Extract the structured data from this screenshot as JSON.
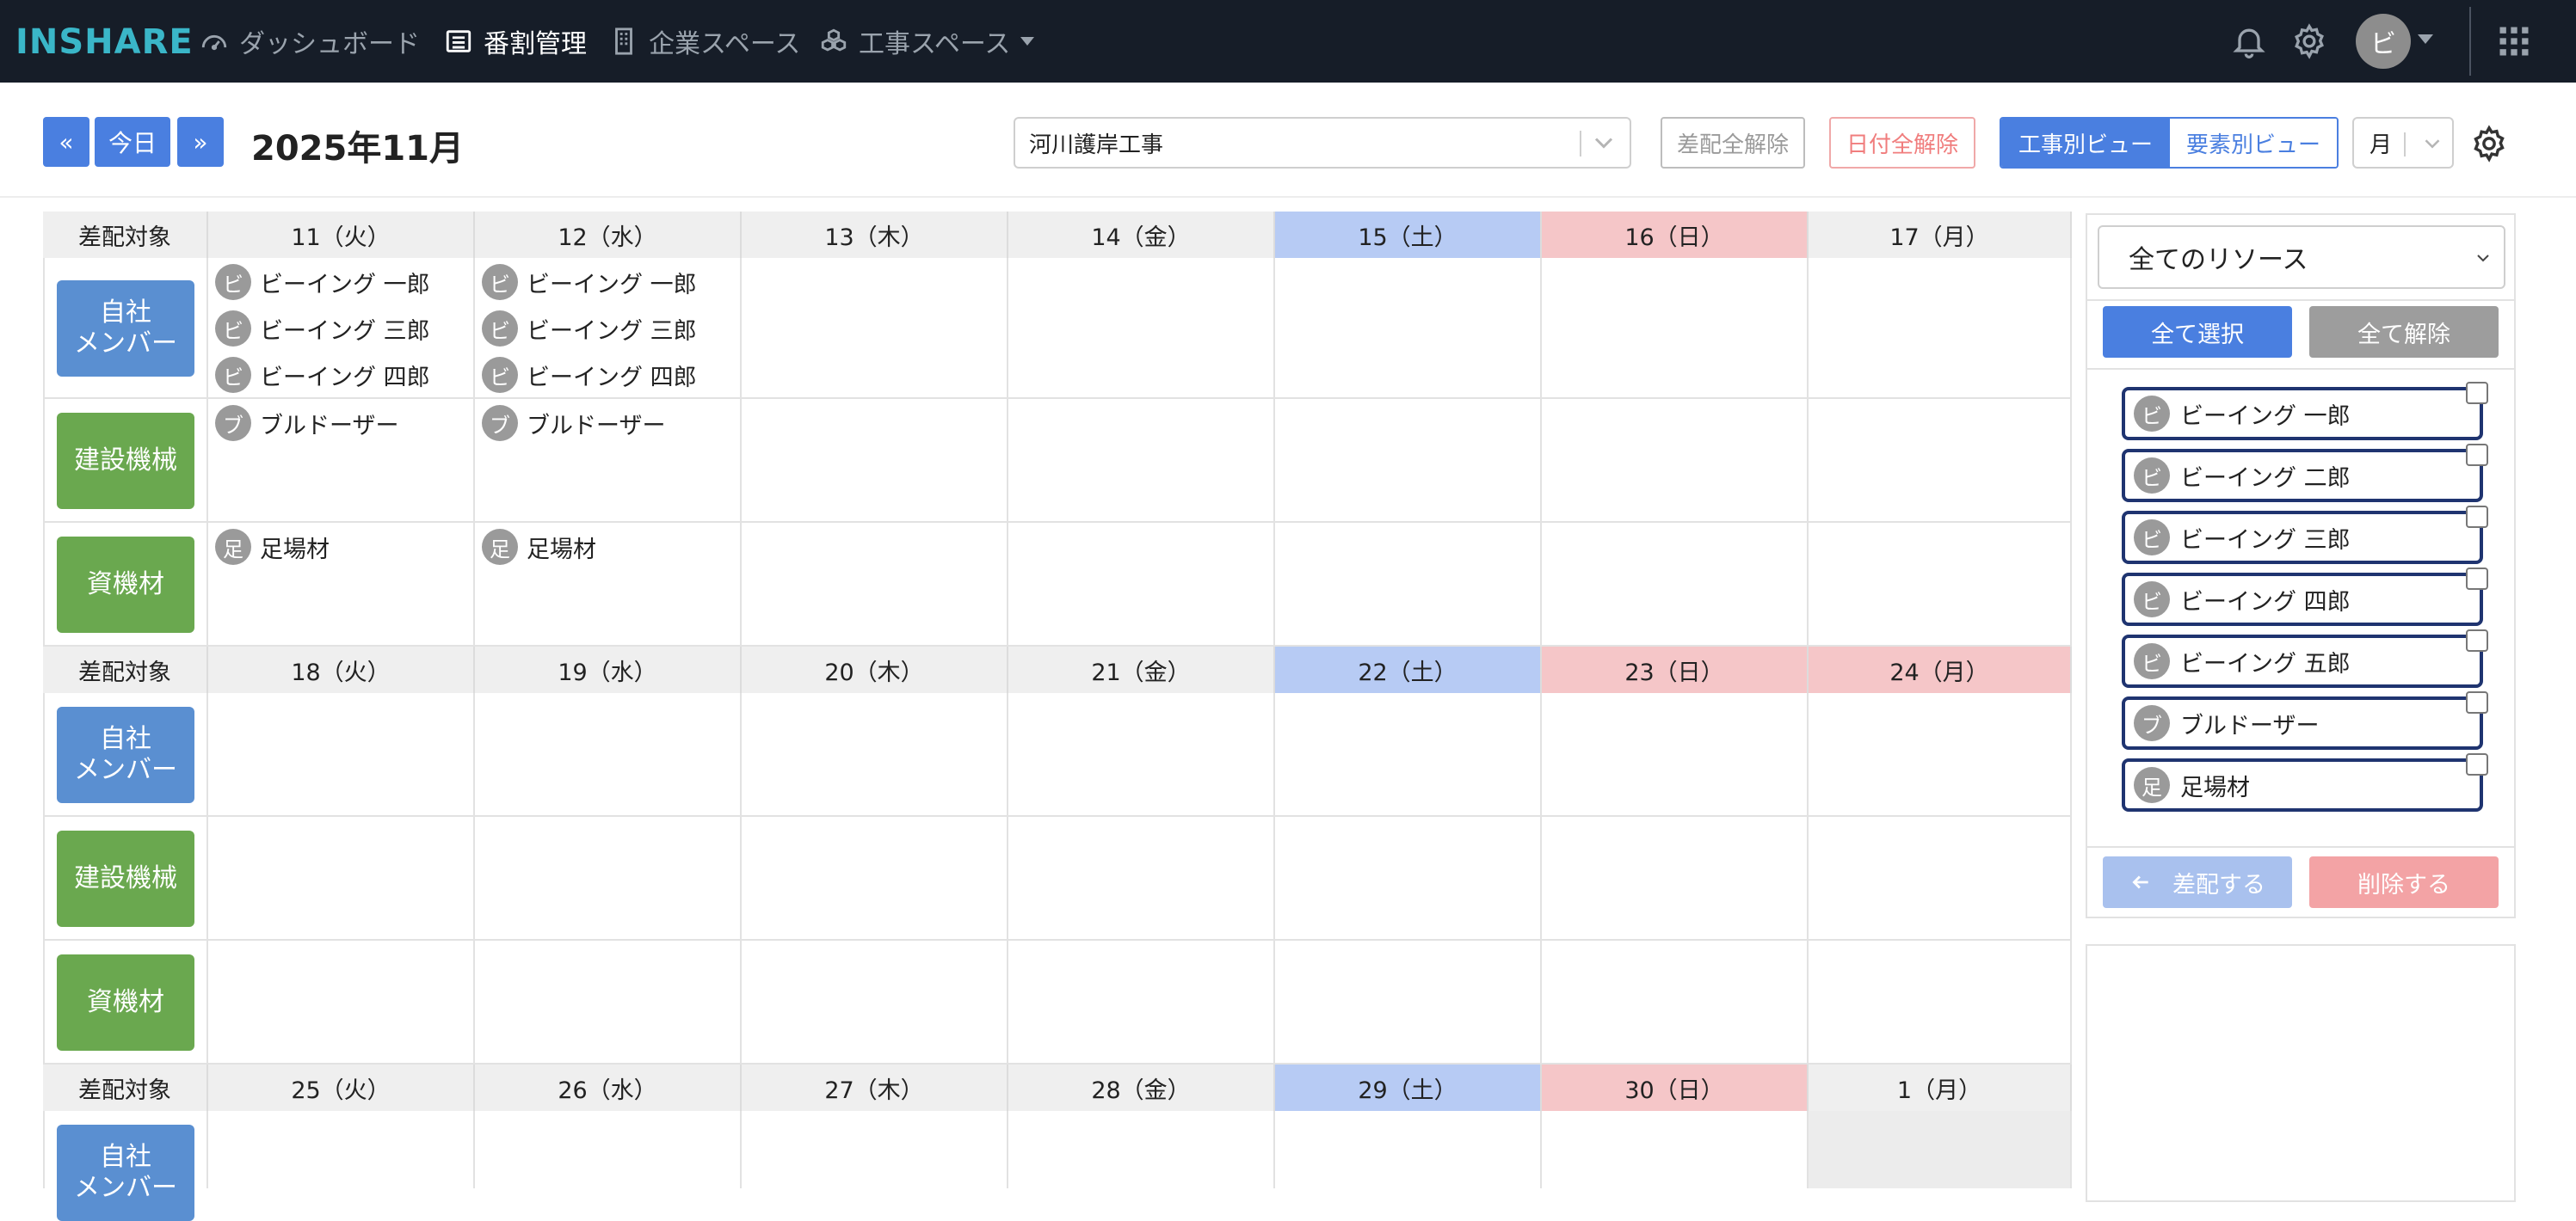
{
  "nav": {
    "logo": "INSHARE",
    "items": [
      {
        "label": "ダッシュボード",
        "icon": "dashboard-icon"
      },
      {
        "label": "番割管理",
        "icon": "list-icon"
      },
      {
        "label": "企業スペース",
        "icon": "building-icon"
      },
      {
        "label": "工事スペース",
        "icon": "cubes-icon"
      }
    ],
    "avatar": "ビ"
  },
  "toolbar": {
    "prev": "«",
    "today": "今日",
    "next": "»",
    "month": "2025年11月",
    "project": "河川護岸工事",
    "clear_assign": "差配全解除",
    "clear_date": "日付全解除",
    "view_project": "工事別ビュー",
    "view_element": "要素別ビュー",
    "period": "月"
  },
  "calendar": {
    "target_label": "差配対象",
    "categories": [
      {
        "label": "自社\nメンバー",
        "lines": [
          "自社",
          "メンバー"
        ]
      },
      {
        "label": "建設機械"
      },
      {
        "label": "資機材"
      }
    ],
    "weeks": [
      {
        "days": [
          "11（火）",
          "12（水）",
          "13（木）",
          "14（金）",
          "15（土）",
          "16（日）",
          "17（月）"
        ],
        "members": [
          [
            {
              "av": "ビ",
              "name": "ビーイング 一郎"
            },
            {
              "av": "ビ",
              "name": "ビーイング 三郎"
            },
            {
              "av": "ビ",
              "name": "ビーイング 四郎"
            }
          ],
          [
            {
              "av": "ビ",
              "name": "ビーイング 一郎"
            },
            {
              "av": "ビ",
              "name": "ビーイング 三郎"
            },
            {
              "av": "ビ",
              "name": "ビーイング 四郎"
            }
          ]
        ],
        "machines": [
          {
            "av": "ブ",
            "name": "ブルドーザー"
          },
          {
            "av": "ブ",
            "name": "ブルドーザー"
          }
        ],
        "materials": [
          {
            "av": "足",
            "name": "足場材"
          },
          {
            "av": "足",
            "name": "足場材"
          }
        ]
      },
      {
        "days": [
          "18（火）",
          "19（水）",
          "20（木）",
          "21（金）",
          "22（土）",
          "23（日）",
          "24（月）"
        ]
      },
      {
        "days": [
          "25（火）",
          "26（水）",
          "27（木）",
          "28（金）",
          "29（土）",
          "30（日）",
          "1（月）"
        ]
      }
    ]
  },
  "panel": {
    "resource_filter": "全てのリソース",
    "select_all": "全て選択",
    "deselect_all": "全て解除",
    "resources": [
      {
        "av": "ビ",
        "name": "ビーイング 一郎"
      },
      {
        "av": "ビ",
        "name": "ビーイング 二郎"
      },
      {
        "av": "ビ",
        "name": "ビーイング 三郎"
      },
      {
        "av": "ビ",
        "name": "ビーイング 四郎"
      },
      {
        "av": "ビ",
        "name": "ビーイング 五郎"
      },
      {
        "av": "ブ",
        "name": "ブルドーザー"
      },
      {
        "av": "足",
        "name": "足場材"
      }
    ],
    "assign": "差配する",
    "delete": "削除する"
  },
  "colors": {
    "nav_bg": "#161d28",
    "accent": "#4a7fe0",
    "saturday": "#b7cbf4",
    "sunday_holiday": "#f5c6c8",
    "member_badge": "#5a8fd1",
    "machine_badge": "#6aa84f",
    "resource_border": "#1f3470"
  }
}
